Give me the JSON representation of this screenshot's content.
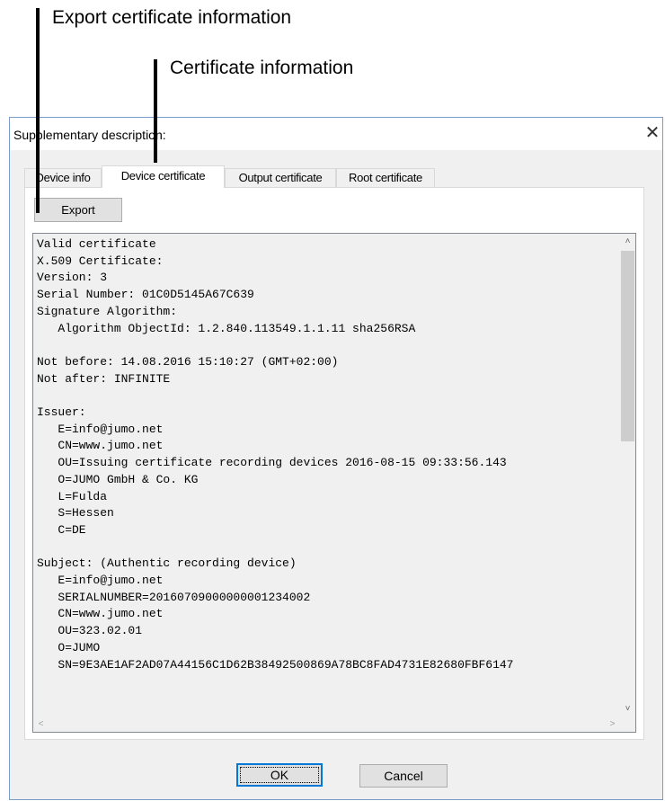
{
  "callouts": {
    "export_info": "Export certificate information",
    "certificate_info": "Certificate information"
  },
  "dialog": {
    "title": "Supplementary description:",
    "close_symbol": "✕"
  },
  "tabs": [
    {
      "label": "Device info",
      "active": false
    },
    {
      "label": "Device certificate",
      "active": true
    },
    {
      "label": "Output certificate",
      "active": false
    },
    {
      "label": "Root certificate",
      "active": false
    }
  ],
  "export_button": {
    "label": "Export"
  },
  "certificate_lines": [
    "Valid certificate",
    "X.509 Certificate:",
    "Version: 3",
    "Serial Number: 01C0D5145A67C639",
    "Signature Algorithm:",
    "   Algorithm ObjectId: 1.2.840.113549.1.1.11 sha256RSA",
    "",
    "Not before: 14.08.2016 15:10:27 (GMT+02:00)",
    "Not after: INFINITE",
    "",
    "Issuer:",
    "   E=info@jumo.net",
    "   CN=www.jumo.net",
    "   OU=Issuing certificate recording devices 2016-08-15 09:33:56.143",
    "   O=JUMO GmbH & Co. KG",
    "   L=Fulda",
    "   S=Hessen",
    "   C=DE",
    "",
    "Subject: (Authentic recording device)",
    "   E=info@jumo.net",
    "   SERIALNUMBER=20160709000000001234002",
    "   CN=www.jumo.net",
    "   OU=323.02.01",
    "   O=JUMO",
    "   SN=9E3AE1AF2AD07A44156C1D62B38492500869A78BC8FAD4731E82680FBF6147"
  ],
  "scrollbar": {
    "up": "˄",
    "down": "˅",
    "left": "<",
    "right": ">"
  },
  "buttons": {
    "ok": "OK",
    "cancel": "Cancel"
  }
}
